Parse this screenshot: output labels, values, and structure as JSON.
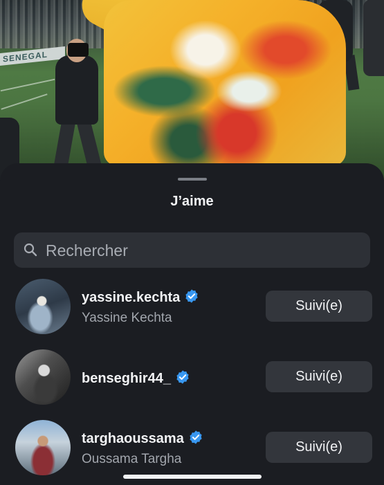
{
  "photo": {
    "banner_text": "SENEGAL",
    "description_icon": "stadium-photo"
  },
  "sheet": {
    "title": "J’aime"
  },
  "search": {
    "placeholder": "Rechercher",
    "icon": "search-icon"
  },
  "likes": [
    {
      "username": "yassine.kechta",
      "full_name": "Yassine Kechta",
      "verified": true,
      "button_label": "Suivi(e)"
    },
    {
      "username": "benseghir44_",
      "full_name": "",
      "verified": true,
      "button_label": "Suivi(e)"
    },
    {
      "username": "targhaoussama",
      "full_name": "Oussama Targha",
      "verified": true,
      "button_label": "Suivi(e)"
    }
  ],
  "colors": {
    "sheet_bg": "#1b1d22",
    "button_bg": "#33363c",
    "verified_blue": "#3897f0",
    "text_primary": "#f2f3f5",
    "text_secondary": "#a2a6ad"
  }
}
